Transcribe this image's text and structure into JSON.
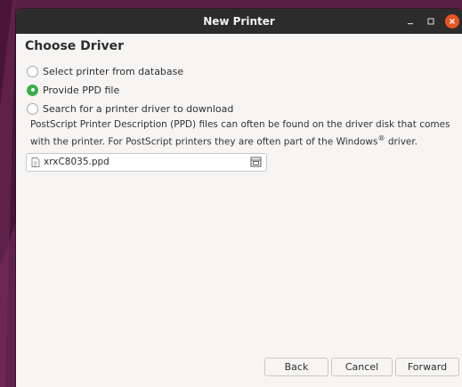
{
  "window": {
    "title": "New Printer",
    "accent_close": "#e95420",
    "radio_accent": "#3cae4c"
  },
  "page": {
    "heading": "Choose Driver"
  },
  "options": [
    {
      "label": "Select printer from database",
      "checked": false
    },
    {
      "label": "Provide PPD file",
      "checked": true
    },
    {
      "label": "Search for a printer driver to download",
      "checked": false
    }
  ],
  "description": {
    "text": "PostScript Printer Description (PPD) files can often be found on the driver disk that comes with the printer. For PostScript printers they are often part of the Windows",
    "trademark": "®",
    "suffix": " driver."
  },
  "file_chooser": {
    "value": "xrxC8035.ppd",
    "file_icon": "document-icon",
    "open_icon": "folder-browse-icon"
  },
  "buttons": {
    "back": "Back",
    "cancel": "Cancel",
    "forward": "Forward"
  }
}
